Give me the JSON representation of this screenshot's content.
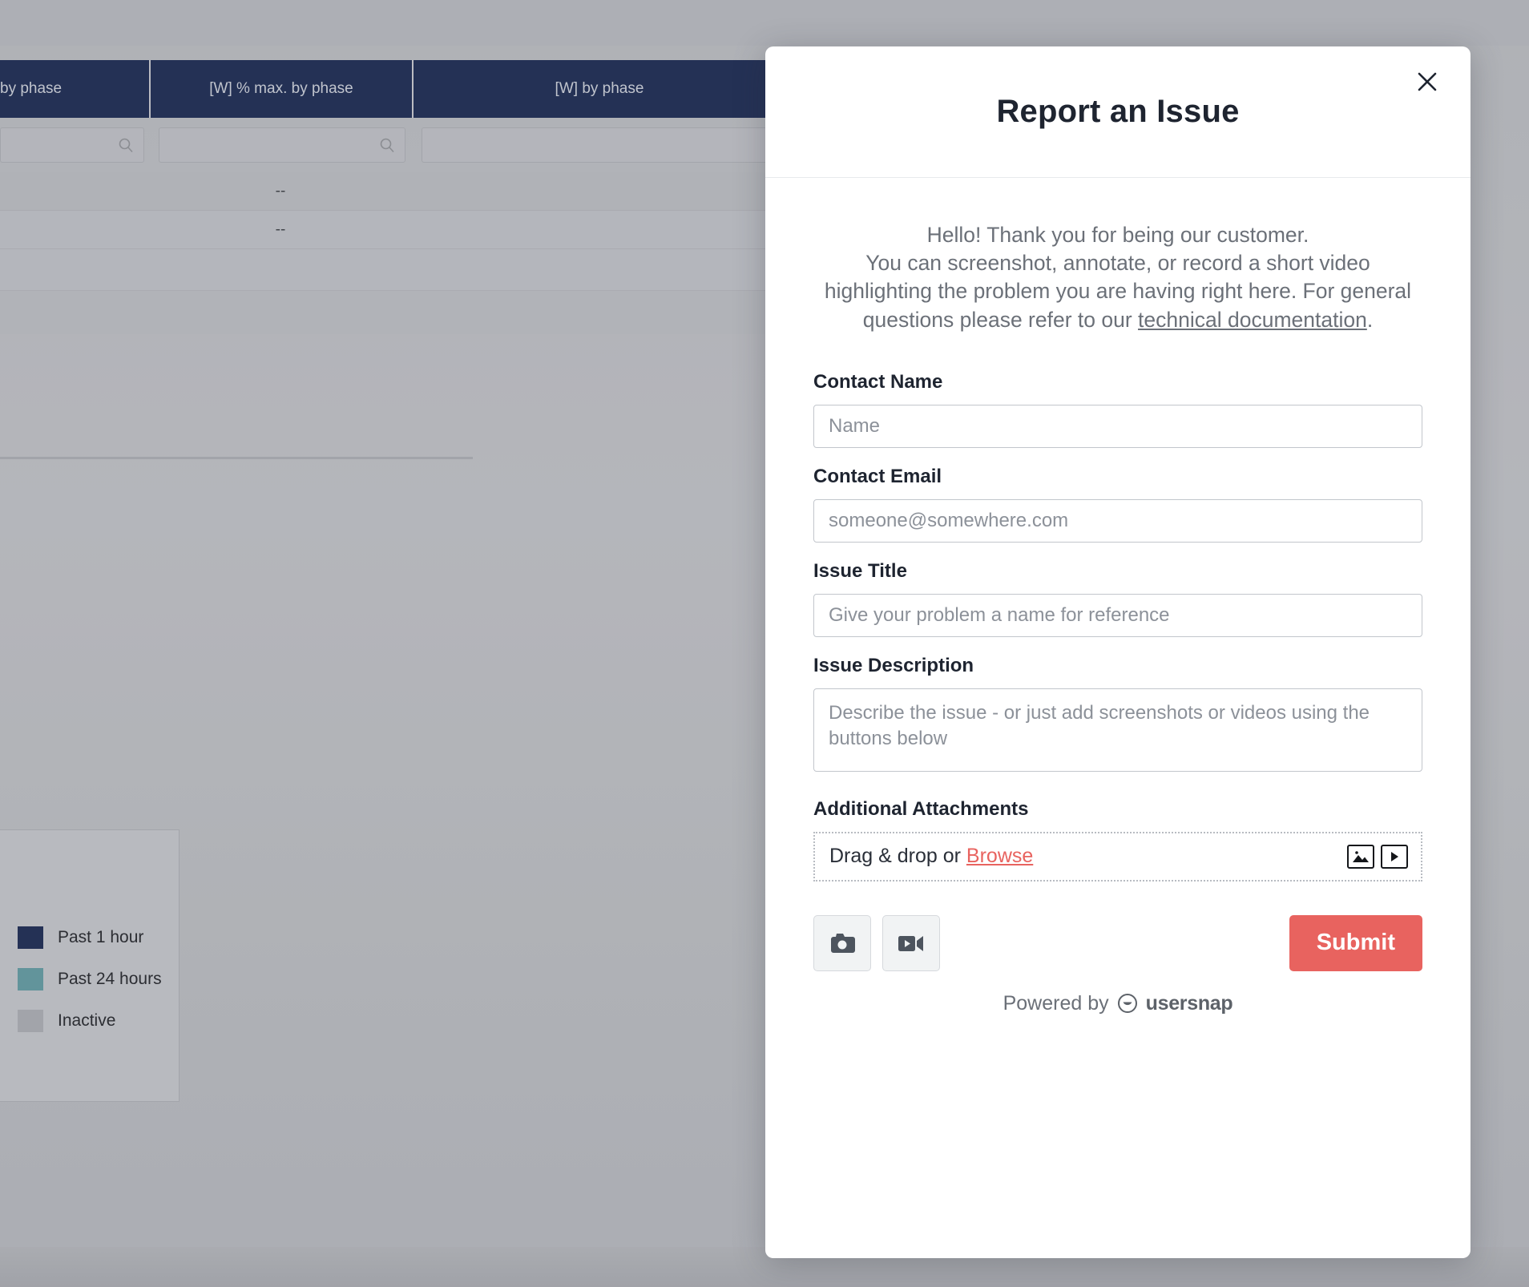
{
  "background": {
    "table": {
      "headers": [
        "by phase",
        "[W] % max. by phase",
        "[W] by phase"
      ],
      "rows": [
        {
          "value": "--"
        },
        {
          "value": "--"
        },
        {
          "value": ""
        },
        {
          "value": ""
        }
      ],
      "filter_placeholder": ""
    },
    "legend": {
      "items": [
        {
          "label": "Past 1 hour",
          "color": "#1b2a51"
        },
        {
          "label": "Past 24 hours",
          "color": "#60989f"
        },
        {
          "label": "Inactive",
          "color": "#a8aaaf"
        }
      ]
    }
  },
  "modal": {
    "title": "Report an Issue",
    "close_label": "×",
    "intro": {
      "line1": "Hello!  Thank you for being our customer.",
      "line2": "You can screenshot, annotate, or record a short video",
      "line3": "highlighting the problem you are having right here.  For general",
      "line4_before": "questions please refer to our ",
      "link_text": "technical documentation",
      "line4_after": "."
    },
    "fields": {
      "contact_name": {
        "label": "Contact Name",
        "placeholder": "Name",
        "value": ""
      },
      "contact_email": {
        "label": "Contact Email",
        "placeholder": "someone@somewhere.com",
        "value": ""
      },
      "issue_title": {
        "label": "Issue Title",
        "placeholder": "Give your problem a name for reference",
        "value": ""
      },
      "issue_description": {
        "label": "Issue Description",
        "placeholder": "Describe the issue - or just add screenshots or videos using the buttons below",
        "value": ""
      }
    },
    "attachments": {
      "label": "Additional Attachments",
      "drop_text": "Drag & drop or ",
      "browse_label": "Browse",
      "icons": [
        "image-attachment-icon",
        "video-attachment-icon"
      ]
    },
    "actions": {
      "screenshot_icon": "camera-icon",
      "video_icon": "video-camera-icon",
      "submit_label": "Submit"
    },
    "footer": {
      "powered_by": "Powered by",
      "brand": "usersnap"
    },
    "colors": {
      "accent": "#e8635f",
      "title": "#1e2430",
      "body_text": "#6b7078",
      "table_header": "#1b2a51"
    }
  }
}
